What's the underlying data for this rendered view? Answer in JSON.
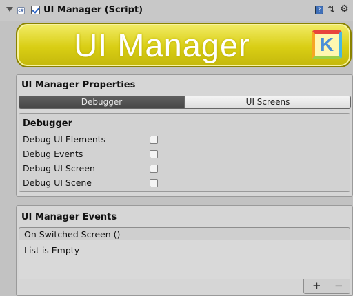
{
  "component": {
    "title": "UI Manager (Script)",
    "enabled": true,
    "icons": [
      "fold-arrow-icon",
      "script-icon",
      "help-icon",
      "preset-icon",
      "gear-icon"
    ]
  },
  "banner": {
    "text": "UI Manager",
    "logo_letter": "K"
  },
  "properties": {
    "title": "UI Manager Properties",
    "tabs": [
      {
        "label": "Debugger",
        "active": true
      },
      {
        "label": "UI Screens",
        "active": false
      }
    ],
    "debugger": {
      "title": "Debugger",
      "rows": [
        {
          "label": "Debug UI Elements",
          "checked": false
        },
        {
          "label": "Debug Events",
          "checked": false
        },
        {
          "label": "Debug UI Screen",
          "checked": false
        },
        {
          "label": "Debug UI Scene",
          "checked": false
        }
      ]
    }
  },
  "events": {
    "title": "UI Manager Events",
    "event_name": "On Switched Screen ()",
    "empty_text": "List is Empty",
    "add_label": "+",
    "remove_label": "−"
  },
  "colors": {
    "banner_yellow": "#d9ce14",
    "active_tab": "#4f4f4f",
    "background": "#c2c2c2"
  }
}
